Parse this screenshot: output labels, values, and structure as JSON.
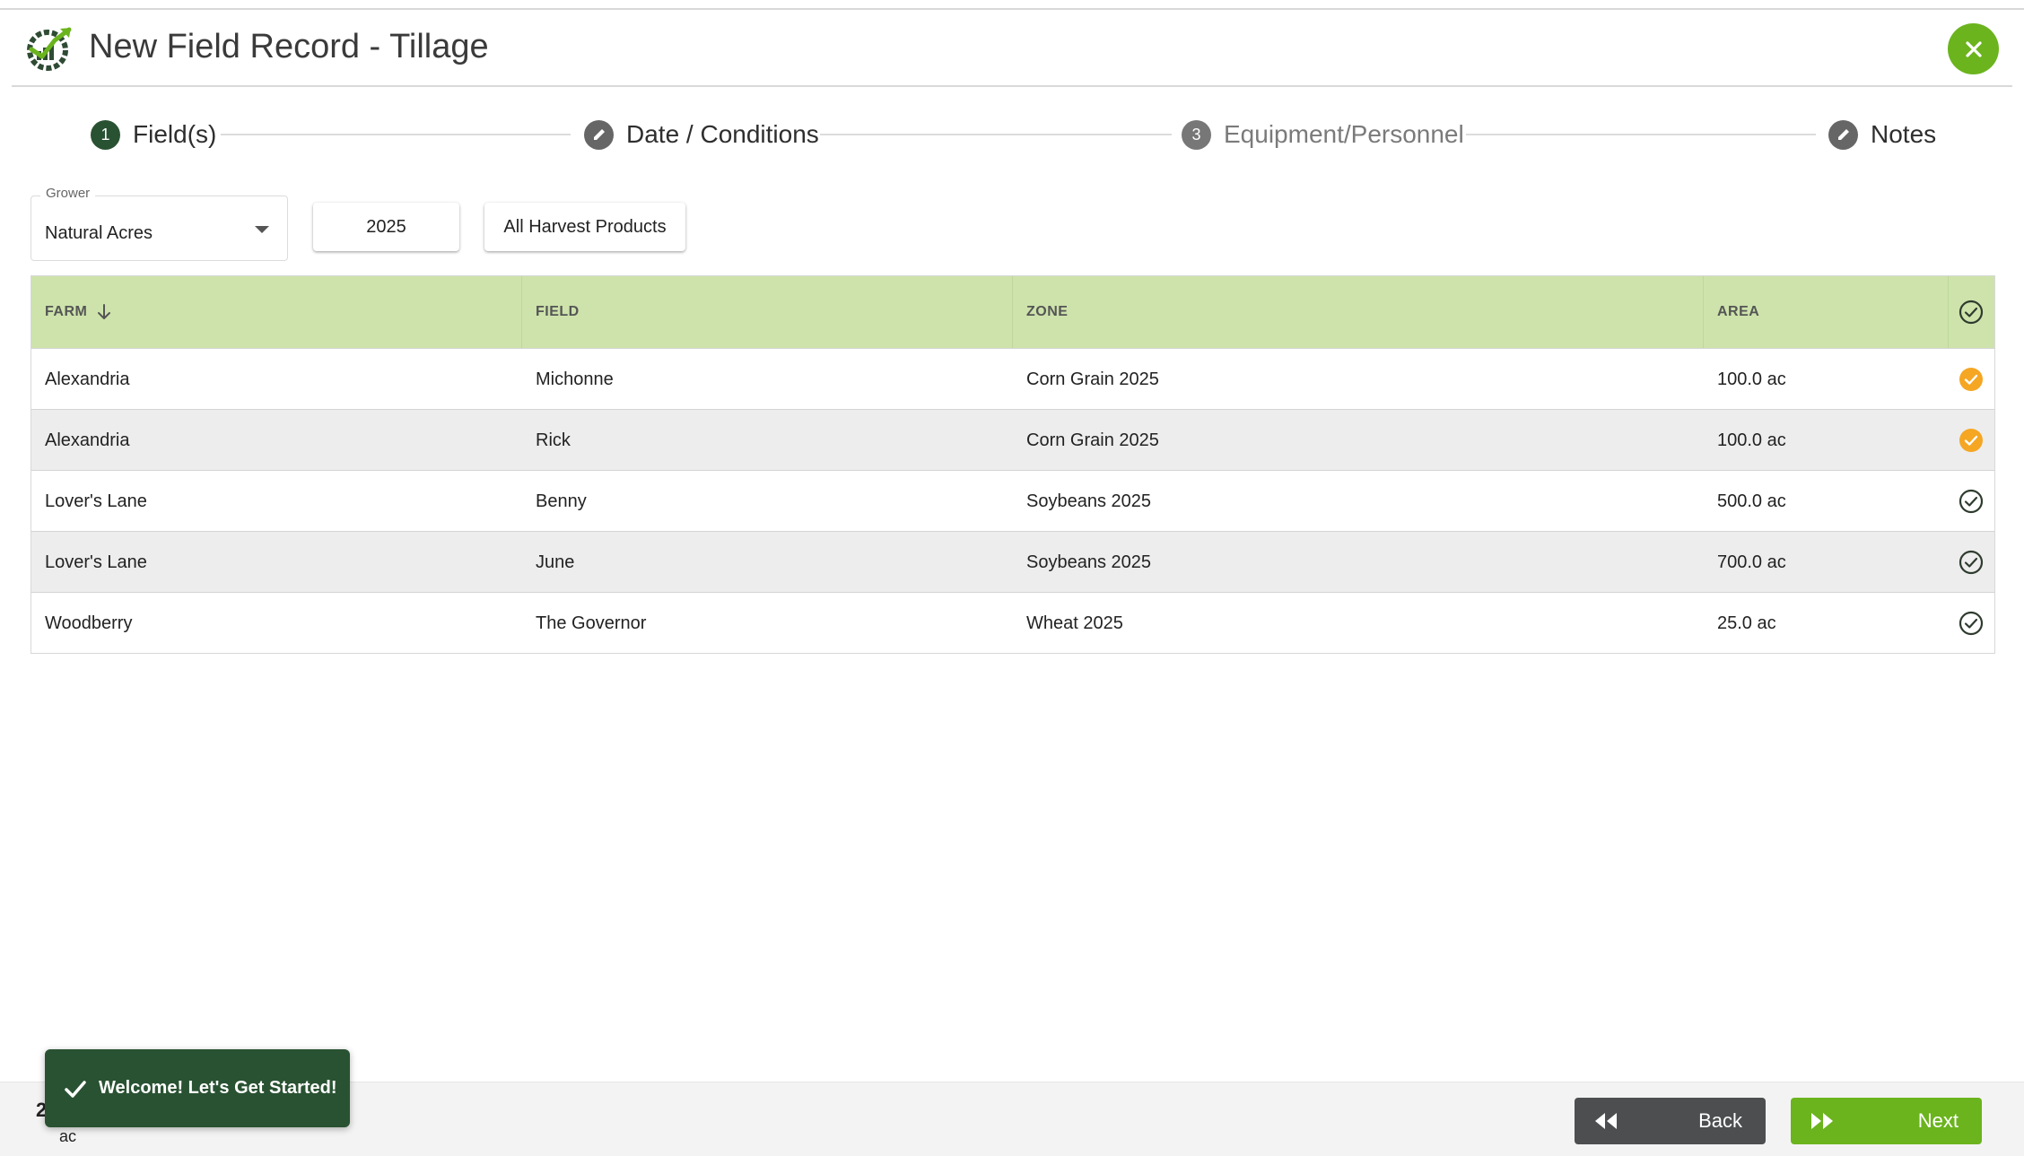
{
  "header": {
    "title": "New Field Record - Tillage",
    "logo_icon": "growth-chart-logo-icon",
    "close_icon": "close-icon"
  },
  "stepper": {
    "steps": [
      {
        "marker": "1",
        "label": "Field(s)",
        "state": "current"
      },
      {
        "marker": "pencil-icon",
        "label": "Date / Conditions",
        "state": "editable"
      },
      {
        "marker": "3",
        "label": "Equipment/Personnel",
        "state": "inactive"
      },
      {
        "marker": "pencil-icon",
        "label": "Notes",
        "state": "editable"
      }
    ]
  },
  "filters": {
    "grower_label": "Grower",
    "grower_value": "Natural Acres",
    "year": "2025",
    "products": "All Harvest Products"
  },
  "table": {
    "columns": [
      "FARM",
      "FIELD",
      "ZONE",
      "AREA"
    ],
    "sort_icon": "arrow-down-icon",
    "header_check_icon": "check-circle-outline-icon",
    "rows": [
      {
        "farm": "Alexandria",
        "field": "Michonne",
        "zone": "Corn Grain 2025",
        "area": "100.0 ac",
        "selected": true
      },
      {
        "farm": "Alexandria",
        "field": "Rick",
        "zone": "Corn Grain 2025",
        "area": "100.0 ac",
        "selected": true
      },
      {
        "farm": "Lover's Lane",
        "field": "Benny",
        "zone": "Soybeans 2025",
        "area": "500.0 ac",
        "selected": false
      },
      {
        "farm": "Lover's Lane",
        "field": "June",
        "zone": "Soybeans 2025",
        "area": "700.0 ac",
        "selected": false
      },
      {
        "farm": "Woodberry",
        "field": "The Governor",
        "zone": "Wheat 2025",
        "area": "25.0 ac",
        "selected": false
      }
    ]
  },
  "footer": {
    "total_value": "2",
    "total_unit": "ac",
    "back_label": "Back",
    "next_label": "Next",
    "back_icon": "rewind-icon",
    "next_icon": "fast-forward-icon"
  },
  "toast": {
    "text": "Welcome! Let's Get Started!",
    "icon": "checkmark-icon"
  },
  "colors": {
    "primary_dark": "#295232",
    "accent_green": "#6bb41e",
    "header_bg": "#cde3ab",
    "selected_orange": "#f5a623",
    "back_button": "#4c4e50"
  }
}
